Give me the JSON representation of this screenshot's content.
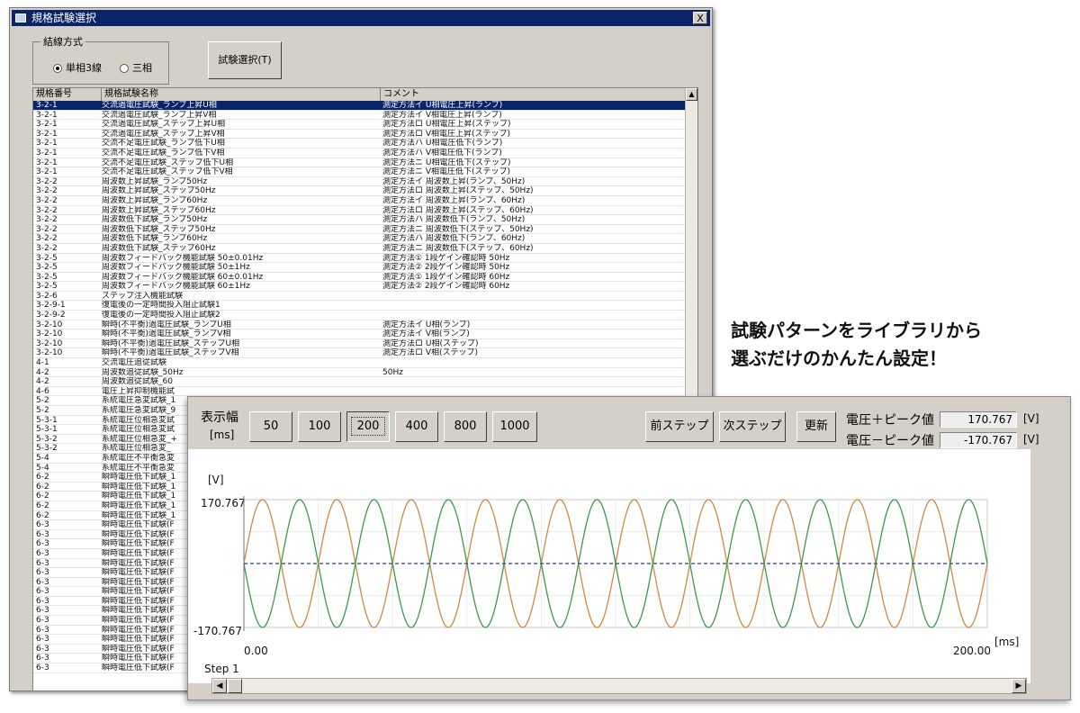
{
  "win1": {
    "title": "規格試験選択",
    "close_label": "X",
    "wiring_group": {
      "legend": "結線方式",
      "options": [
        {
          "label": "単相3線",
          "selected": true
        },
        {
          "label": "三相",
          "selected": false
        }
      ]
    },
    "test_select_button": "試験選択(T)",
    "list": {
      "columns": [
        "規格番号",
        "規格試験名称",
        "コメント"
      ],
      "selected_row": 0,
      "rows": [
        [
          "3-2-1",
          "交流過電圧試験_ランプ上昇U相",
          "測定方法イ U相電圧上昇(ランプ)"
        ],
        [
          "3-2-1",
          "交流過電圧試験_ランプ上昇V相",
          "測定方法イ V相電圧上昇(ランプ)"
        ],
        [
          "3-2-1",
          "交流過電圧試験_ステップ上昇U相",
          "測定方法ロ U相電圧上昇(ステップ)"
        ],
        [
          "3-2-1",
          "交流過電圧試験_ステップ上昇V相",
          "測定方法ロ V相電圧上昇(ステップ)"
        ],
        [
          "3-2-1",
          "交流不足電圧試験_ランプ低下U相",
          "測定方法ハ U相電圧低下(ランプ)"
        ],
        [
          "3-2-1",
          "交流不足電圧試験_ランプ低下V相",
          "測定方法ハ V相電圧低下(ランプ)"
        ],
        [
          "3-2-1",
          "交流不足電圧試験_ステップ低下U相",
          "測定方法ニ U相電圧低下(ステップ)"
        ],
        [
          "3-2-1",
          "交流不足電圧試験_ステップ低下V相",
          "測定方法ニ V相電圧低下(ステップ)"
        ],
        [
          "3-2-2",
          "周波数上昇試験_ランプ50Hz",
          "測定方法イ 周波数上昇(ランプ、50Hz)"
        ],
        [
          "3-2-2",
          "周波数上昇試験_ステップ50Hz",
          "測定方法ロ 周波数上昇(ステップ、50Hz)"
        ],
        [
          "3-2-2",
          "周波数上昇試験_ランプ60Hz",
          "測定方法イ 周波数上昇(ランプ、60Hz)"
        ],
        [
          "3-2-2",
          "周波数上昇試験_ステップ60Hz",
          "測定方法ロ 周波数上昇(ステップ、60Hz)"
        ],
        [
          "3-2-2",
          "周波数低下試験_ランプ50Hz",
          "測定方法ハ 周波数低下(ランプ、50Hz)"
        ],
        [
          "3-2-2",
          "周波数低下試験_ステップ50Hz",
          "測定方法ニ 周波数低下(ステップ、50Hz)"
        ],
        [
          "3-2-2",
          "周波数低下試験_ランプ60Hz",
          "測定方法ハ 周波数低下(ランプ、60Hz)"
        ],
        [
          "3-2-2",
          "周波数低下試験_ステップ60Hz",
          "測定方法ニ 周波数低下(ステップ、60Hz)"
        ],
        [
          "3-2-5",
          "周波数フィードバック機能試験 50±0.01Hz",
          "測定方法① 1段ゲイン確認時 50Hz"
        ],
        [
          "3-2-5",
          "周波数フィードバック機能試験 50±1Hz",
          "測定方法② 2段ゲイン確認時 50Hz"
        ],
        [
          "3-2-5",
          "周波数フィードバック機能試験 60±0.01Hz",
          "測定方法① 1段ゲイン確認時 60Hz"
        ],
        [
          "3-2-5",
          "周波数フィードバック機能試験 60±1Hz",
          "測定方法② 2段ゲイン確認時 60Hz"
        ],
        [
          "3-2-6",
          "ステップ注入機能試験",
          ""
        ],
        [
          "3-2-9-1",
          "復電後の一定時間投入阻止試験1",
          ""
        ],
        [
          "3-2-9-2",
          "復電後の一定時間投入阻止試験2",
          ""
        ],
        [
          "3-2-10",
          "瞬時(不平衡)過電圧試験_ランプU相",
          "測定方法イ U相(ランプ)"
        ],
        [
          "3-2-10",
          "瞬時(不平衡)過電圧試験_ランプV相",
          "測定方法イ V相(ランプ)"
        ],
        [
          "3-2-10",
          "瞬時(不平衡)過電圧試験_ステップU相",
          "測定方法ロ U相(ステップ)"
        ],
        [
          "3-2-10",
          "瞬時(不平衡)過電圧試験_ステップV相",
          "測定方法ロ V相(ステップ)"
        ],
        [
          "4-1",
          "交流電圧追従試験",
          ""
        ],
        [
          "4-2",
          "周波数追従試験_50Hz",
          "50Hz"
        ],
        [
          "4-2",
          "周波数追従試験_60",
          ""
        ],
        [
          "4-6",
          "電圧上昇抑制機能試",
          ""
        ],
        [
          "5-2",
          "系統電圧急変試験_1",
          ""
        ],
        [
          "5-2",
          "系統電圧急変試験_9",
          ""
        ],
        [
          "5-3-1",
          "系統電圧位相急変試",
          ""
        ],
        [
          "5-3-1",
          "系統電圧位相急変試",
          ""
        ],
        [
          "5-3-2",
          "系統電圧位相急変_+",
          ""
        ],
        [
          "5-3-2",
          "系統電圧位相急変_",
          ""
        ],
        [
          "5-4",
          "系統電圧不平衡急変",
          ""
        ],
        [
          "5-4",
          "系統電圧不平衡急変",
          ""
        ],
        [
          "6-2",
          "瞬時電圧低下試験_1",
          ""
        ],
        [
          "6-2",
          "瞬時電圧低下試験_1",
          ""
        ],
        [
          "6-2",
          "瞬時電圧低下試験_1",
          ""
        ],
        [
          "6-2",
          "瞬時電圧低下試験_1",
          ""
        ],
        [
          "6-2",
          "瞬時電圧低下試験_1",
          ""
        ],
        [
          "6-3",
          "瞬時電圧低下試験(F",
          ""
        ],
        [
          "6-3",
          "瞬時電圧低下試験(F",
          ""
        ],
        [
          "6-3",
          "瞬時電圧低下試験(F",
          ""
        ],
        [
          "6-3",
          "瞬時電圧低下試験(F",
          ""
        ],
        [
          "6-3",
          "瞬時電圧低下試験(F",
          ""
        ],
        [
          "6-3",
          "瞬時電圧低下試験(F",
          ""
        ],
        [
          "6-3",
          "瞬時電圧低下試験(F",
          ""
        ],
        [
          "6-3",
          "瞬時電圧低下試験(F",
          ""
        ],
        [
          "6-3",
          "瞬時電圧低下試験(F",
          ""
        ],
        [
          "6-3",
          "瞬時電圧低下試験(F",
          ""
        ],
        [
          "6-3",
          "瞬時電圧低下試験(F",
          ""
        ],
        [
          "6-3",
          "瞬時電圧低下試験(F",
          ""
        ],
        [
          "6-3",
          "瞬時電圧低下試験(F",
          ""
        ],
        [
          "6-3",
          "瞬時電圧低下試験(F",
          ""
        ],
        [
          "6-3",
          "瞬時電圧低下試験(F",
          ""
        ],
        [
          "6-3",
          "瞬時電圧低下試験(F",
          ""
        ]
      ]
    }
  },
  "callout": {
    "line1": "試験パターンをライブラリから",
    "line2": "選ぶだけのかんたん設定！"
  },
  "win2": {
    "display_width_label": "表示幅",
    "display_width_unit": "[ms]",
    "width_buttons": [
      "50",
      "100",
      "200",
      "400",
      "800",
      "1000"
    ],
    "selected_width": "200",
    "prev_step_button": "前ステップ",
    "next_step_button": "次ステップ",
    "refresh_button": "更新",
    "peak_pos_label": "電圧＋ピーク値",
    "peak_pos_value": "170.767",
    "peak_neg_label": "電圧－ピーク値",
    "peak_neg_value": "-170.767",
    "unit": "[V]",
    "step_label": "Step 1"
  },
  "chart_data": {
    "type": "line",
    "ylabel": "[V]",
    "xlabel": "[ms]",
    "y_top_label": "170.767",
    "y_bottom_label": "-170.767",
    "x_start_label": "0.00",
    "x_end_label": "200.00",
    "xlim": [
      0,
      200
    ],
    "ylim": [
      -170.767,
      170.767
    ],
    "grid": true,
    "frequency_hz": 50,
    "cycles_shown": 10,
    "series": [
      {
        "amplitude": 170.767,
        "phase_deg": 0,
        "color": "#d2873f",
        "style": "solid"
      },
      {
        "amplitude": 170.767,
        "phase_deg": 180,
        "color": "#3a9a4a",
        "style": "solid"
      },
      {
        "amplitude": 0,
        "phase_deg": 0,
        "color": "#2a3f8f",
        "style": "dashed"
      }
    ]
  }
}
